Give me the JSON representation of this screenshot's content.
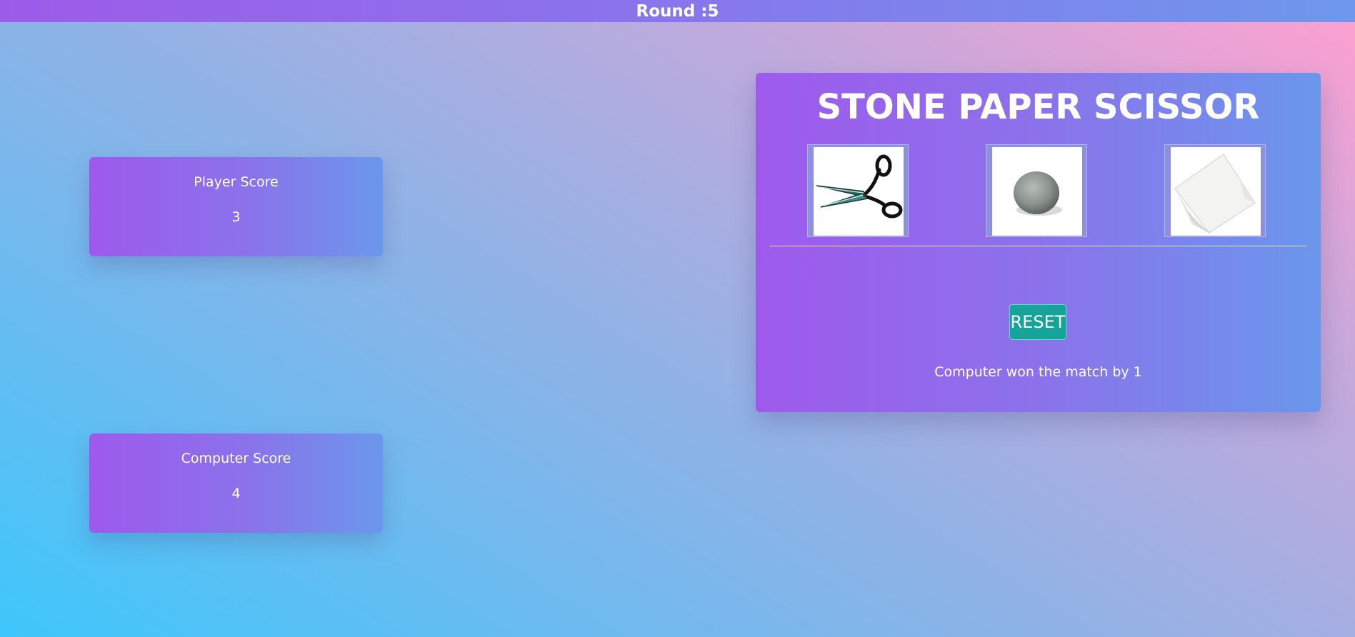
{
  "header": {
    "round_text": "Round :5"
  },
  "scores": {
    "player_label": "Player Score",
    "player_value": "3",
    "computer_label": "Computer Score",
    "computer_value": "4"
  },
  "game": {
    "title": "STONE PAPER SCISSOR",
    "choices": [
      {
        "name": "scissor",
        "icon": "scissors-image"
      },
      {
        "name": "stone",
        "icon": "stone-image"
      },
      {
        "name": "paper",
        "icon": "paper-image"
      }
    ],
    "reset_label": "RESET",
    "result_text": "Computer won the match by 1"
  },
  "colors": {
    "panel_gradient_start": "#9f5aec",
    "panel_gradient_end": "#6a97ec",
    "reset_button": "#16a39a",
    "background_start": "#3ec7fb",
    "background_end": "#ff9fd0"
  }
}
